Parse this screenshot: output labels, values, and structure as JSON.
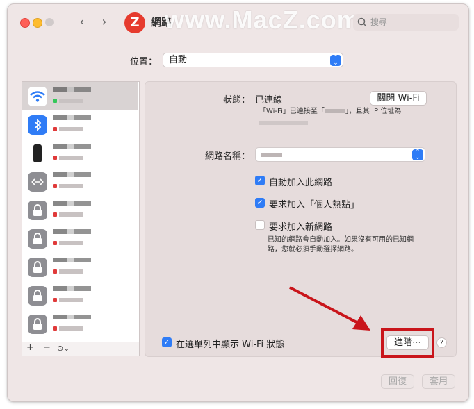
{
  "window": {
    "title": "網路",
    "watermark": "www.MacZ.com",
    "logo_letter": "Z",
    "search_placeholder": "搜尋",
    "back_symbol": "‹",
    "forward_symbol": "›"
  },
  "location": {
    "label": "位置：",
    "value": "自動"
  },
  "sidebar": {
    "items": [
      {
        "icon": "wifi-icon",
        "status_color": "#34c759",
        "selected": true
      },
      {
        "icon": "bluetooth-icon",
        "status_color": "#e03a3a",
        "selected": false
      },
      {
        "icon": "iphone-icon",
        "status_color": "#e03a3a",
        "selected": false
      },
      {
        "icon": "vpn-arrows-icon",
        "status_color": "#e03a3a",
        "selected": false
      },
      {
        "icon": "lock-icon",
        "status_color": "#e03a3a",
        "selected": false
      },
      {
        "icon": "lock-icon",
        "status_color": "#e03a3a",
        "selected": false
      },
      {
        "icon": "lock-icon",
        "status_color": "#e03a3a",
        "selected": false
      },
      {
        "icon": "lock-icon",
        "status_color": "#e03a3a",
        "selected": false
      },
      {
        "icon": "lock-icon",
        "status_color": "#e03a3a",
        "selected": false
      }
    ],
    "toolbar": {
      "add": "+",
      "remove": "−",
      "more": "⊙⌄"
    }
  },
  "details": {
    "status_label": "狀態：",
    "status_value": "已連線",
    "turn_off_button": "關閉 Wi-Fi",
    "status_description": "「Wi-Fi」已連接至「",
    "status_description_tail": "」，且其 IP 位址為",
    "network_name_label": "網路名稱：",
    "network_name_value": "",
    "checkbox_auto_join": "自動加入此網路",
    "checkbox_ask_hotspot": "要求加入「個人熱點」",
    "checkbox_ask_new": "要求加入新網路",
    "known_networks_note_1": "已知的網路會自動加入。如果沒有可用的已知網",
    "known_networks_note_2": "路，您就必須手動選擇網路。",
    "show_wifi_status": "在選單列中顯示 Wi-Fi 狀態",
    "advanced_button": "進階⋯",
    "help_button": "?"
  },
  "footer": {
    "revert_button": "回復",
    "apply_button": "套用"
  },
  "colors": {
    "accent": "#2f7cf6",
    "annotation": "#c9151b",
    "connected": "#34c759",
    "disconnected": "#e03a3a"
  },
  "checkboxes": {
    "auto_join": true,
    "ask_hotspot": true,
    "ask_new": false,
    "show_wifi_status": true
  }
}
